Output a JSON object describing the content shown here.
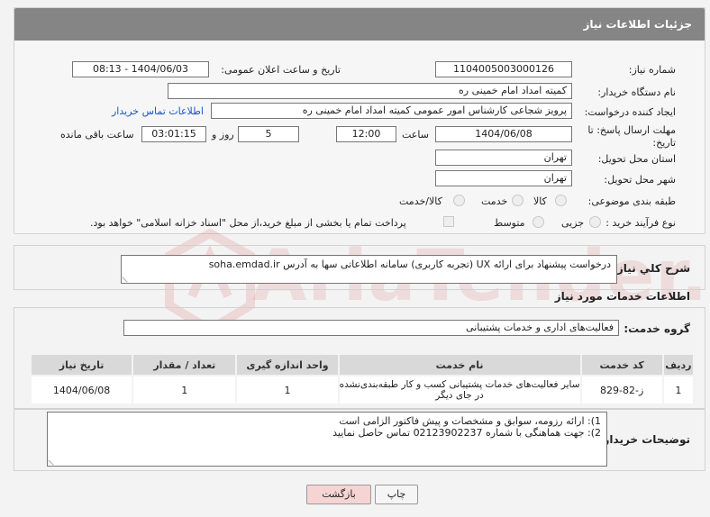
{
  "header": {
    "title": "جزئیات اطلاعات نیاز"
  },
  "fields": {
    "need_number_label": "شماره نیاز:",
    "need_number": "1104005003000126",
    "announce_label": "تاریخ و ساعت اعلان عمومی:",
    "announce_value": "1404/06/03 - 08:13",
    "buyer_org_label": "نام دستگاه خریدار:",
    "buyer_org": "کمیته امداد امام خمینی ره",
    "creator_label": "ایجاد کننده درخواست:",
    "creator": "پرویز شجاعی کارشناس امور عمومی کمیته امداد امام خمینی ره",
    "buyer_contact_link": "اطلاعات تماس خریدار",
    "deadline_label_1": "مهلت ارسال پاسخ: تا",
    "deadline_label_2": "تاریخ:",
    "deadline_date": "1404/06/08",
    "time_label": "ساعت",
    "deadline_time": "12:00",
    "days_value": "5",
    "days_label": "روز و",
    "remaining_time": "03:01:15",
    "remaining_label": "ساعت باقی مانده",
    "province_label": "استان محل تحویل:",
    "province": "تهران",
    "city_label": "شهر محل تحویل:",
    "city": "تهران",
    "category_label": "طبقه بندی موضوعی:",
    "category_options": [
      "کالا",
      "خدمت",
      "کالا/خدمت"
    ],
    "process_label": "نوع فرآیند خرید :",
    "process_options": [
      "جزیی",
      "متوسط"
    ],
    "payment_note": "پرداخت تمام یا بخشی از مبلغ خرید،از محل \"اسناد خزانه اسلامی\" خواهد بود."
  },
  "description": {
    "label": "شرح کلي نياز:",
    "text": "درخواست پیشنهاد برای ارائه UX (تجربه کاربری) سامانه اطلاعاتی سها به آدرس soha.emdad.ir"
  },
  "services": {
    "section_title": "اطلاعات خدمات مورد نیاز",
    "group_label": "گروه خدمت:",
    "group_value": "فعالیت‌های اداری و خدمات پشتیبانی",
    "columns": [
      "ردیف",
      "کد خدمت",
      "نام خدمت",
      "واحد اندازه گیری",
      "تعداد / مقدار",
      "تاریخ نیاز"
    ],
    "rows": [
      {
        "row": "1",
        "code": "ز-82-829",
        "name": "سایر فعالیت‌های خدمات پشتیبانی کسب و کار طبقه‌بندی‌نشده در جای دیگر",
        "unit": "1",
        "qty": "1",
        "date": "1404/06/08"
      }
    ]
  },
  "buyer_notes": {
    "label": "توضیحات خریدار:",
    "line1": "1): ارائه رزومه، سوابق و مشخصات  و پیش فاکتور الزامی است",
    "line2": "2): جهت هماهنگی با شماره 02123902237 تماس حاصل نمایید"
  },
  "buttons": {
    "print": "چاپ",
    "back": "بازگشت"
  },
  "watermark": {
    "text": "AriaTender.neT"
  },
  "colors": {
    "header_bg": "#858585",
    "link": "#1a55c8",
    "back_btn": "#f6d4d4"
  }
}
